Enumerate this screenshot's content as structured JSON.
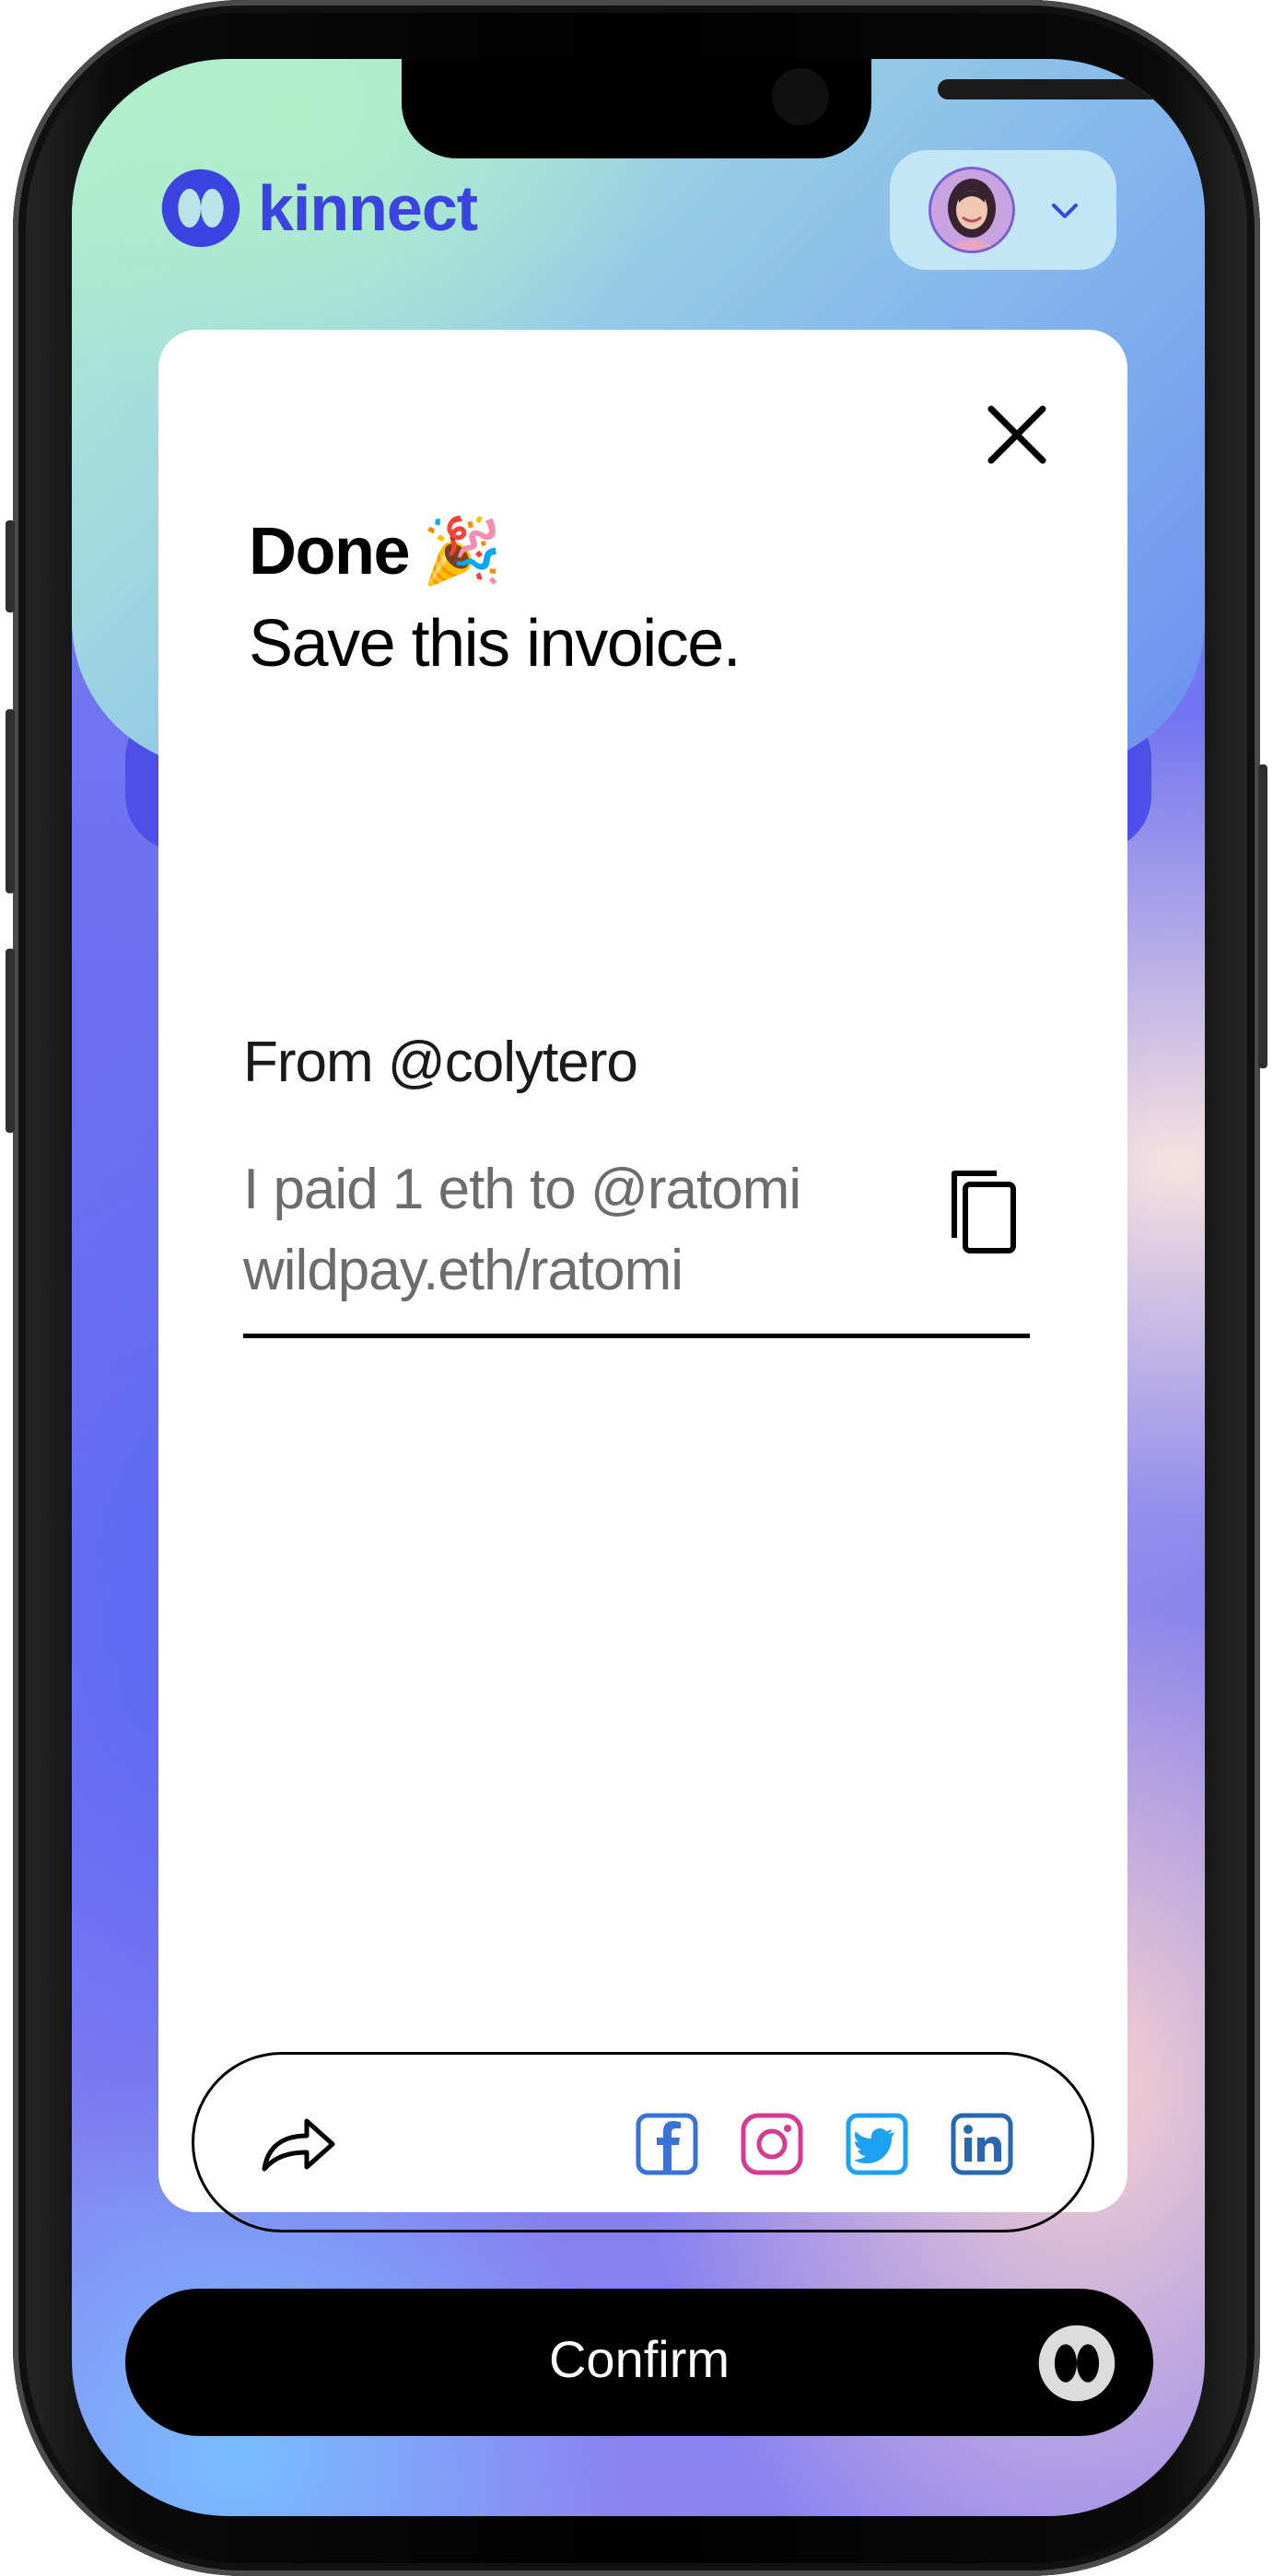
{
  "app": {
    "name": "kinnect"
  },
  "modal": {
    "title": "Done",
    "title_emoji": "🎉",
    "subtitle": "Save this invoice.",
    "from_line": "From @colytero",
    "message_line_1": "I paid 1 eth to @ratomi",
    "message_line_2": "wildpay.eth/ratomi"
  },
  "share": {
    "platforms": [
      "facebook",
      "instagram",
      "twitter",
      "linkedin"
    ]
  },
  "footer": {
    "confirm_label": "Confirm"
  },
  "colors": {
    "brand": "#3b43e0",
    "facebook": "#3a72d8",
    "instagram": "#d53b8f",
    "twitter": "#1da1f2",
    "linkedin": "#2867b2"
  }
}
